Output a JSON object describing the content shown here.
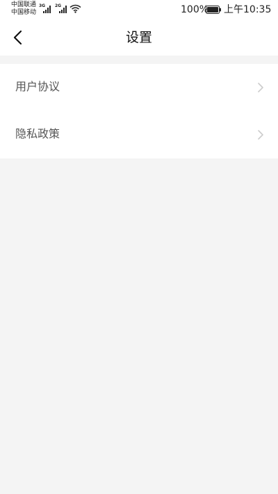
{
  "status_bar": {
    "carrier_1": "中国联通",
    "carrier_2": "中国移动",
    "network_1": "3G",
    "network_2": "2G",
    "battery": "100%",
    "time": "上午10:35"
  },
  "nav": {
    "title": "设置",
    "back_icon": "chevron-left-icon"
  },
  "settings": {
    "items": [
      {
        "label": "用户协议",
        "icon": "chevron-right-icon"
      },
      {
        "label": "隐私政策",
        "icon": "chevron-right-icon"
      }
    ]
  },
  "colors": {
    "page_background": "#f4f4f4",
    "surface": "#ffffff",
    "label_text": "#555555",
    "chevron": "#cccccc"
  }
}
